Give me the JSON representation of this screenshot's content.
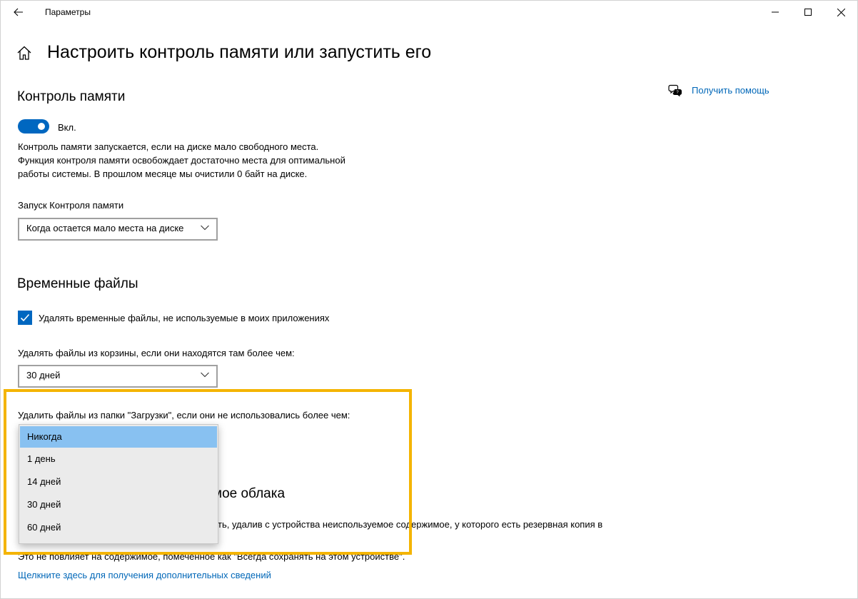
{
  "window": {
    "title": "Параметры"
  },
  "page": {
    "title": "Настроить контроль памяти или запустить его"
  },
  "help": {
    "label": "Получить помощь"
  },
  "storage_sense": {
    "heading": "Контроль памяти",
    "toggle_label": "Вкл.",
    "toggle_on": true,
    "description": "Контроль памяти запускается, если на диске мало свободного места. Функция контроля памяти освобождает достаточно места для оптимальной работы системы. В прошлом месяце мы очистили 0 байт на диске.",
    "run_label": "Запуск Контроля памяти",
    "run_value": "Когда остается мало места на диске"
  },
  "temp_files": {
    "heading": "Временные файлы",
    "delete_temp_label": "Удалять временные файлы, не используемые в моих приложениях",
    "delete_temp_checked": true,
    "recycle_label": "Удалять файлы из корзины, если они находятся там более чем:",
    "recycle_value": "30 дней",
    "downloads_label": "Удалить файлы из папки \"Загрузки\", если они не использовались более чем:",
    "downloads_options": [
      "Никогда",
      "1 день",
      "14 дней",
      "30 дней",
      "60 дней"
    ],
    "downloads_selected": "Никогда"
  },
  "cloud": {
    "heading_partial": "мое облака",
    "text_partial": "ять, удалив с устройства неиспользуемое содержимое, у которого есть резервная копия в",
    "note": "Это не повлияет на содержимое, помеченное как \"Всегда сохранять на этом устройстве\".",
    "link": "Щелкните здесь для получения дополнительных сведений"
  },
  "colors": {
    "accent": "#0067c0",
    "link": "#0067b8",
    "highlight": "#f4b400",
    "selected_item": "#88c1f1"
  },
  "icons": [
    "back-arrow-icon",
    "minimize-icon",
    "maximize-icon",
    "close-icon",
    "home-icon",
    "help-chat-icon",
    "chevron-down-icon",
    "checkmark-icon"
  ]
}
